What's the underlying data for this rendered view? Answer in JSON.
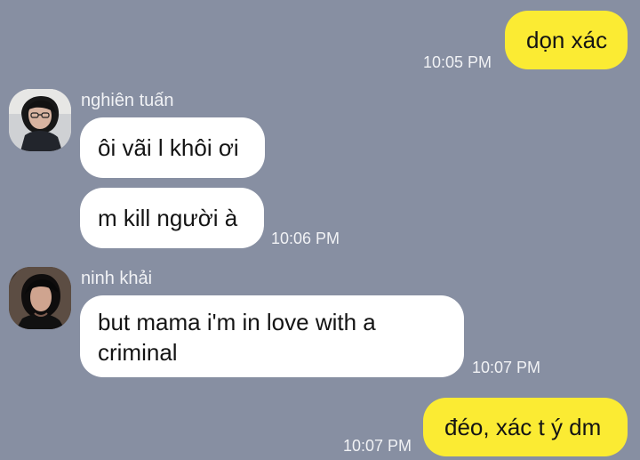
{
  "messages": [
    {
      "text": "dọn xác",
      "time": "10:05 PM"
    },
    {
      "sender": "nghiên tuấn",
      "text": "ôi vãi l khôi ơi"
    },
    {
      "text": "m kill người à",
      "time": "10:06 PM"
    },
    {
      "sender": "ninh khải",
      "text_line1": "but mama i'm in love with a",
      "text_line2": "criminal",
      "time": "10:07 PM"
    },
    {
      "text": "đéo, xác t ý dm",
      "time": "10:07 PM"
    }
  ],
  "icons": {
    "avatar_1": "profile-photo-icon",
    "avatar_2": "profile-photo-icon"
  },
  "colors": {
    "background": "#878fa2",
    "outgoing_bubble": "#fbeb33",
    "incoming_bubble": "#ffffff",
    "meta_text": "#f1f2f5"
  }
}
